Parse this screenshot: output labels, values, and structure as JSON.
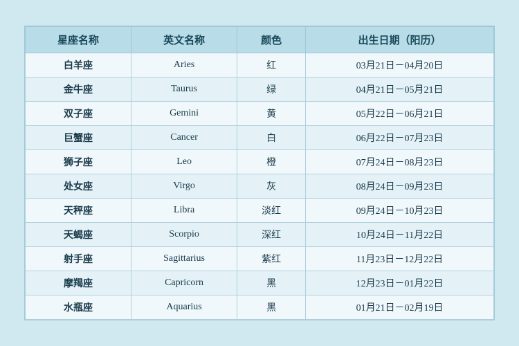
{
  "table": {
    "headers": [
      {
        "key": "chinese_name",
        "label": "星座名称"
      },
      {
        "key": "english_name",
        "label": "英文名称"
      },
      {
        "key": "color",
        "label": "颜色"
      },
      {
        "key": "date_range",
        "label": "出生日期（阳历）"
      }
    ],
    "rows": [
      {
        "chinese_name": "白羊座",
        "english_name": "Aries",
        "color": "红",
        "date_range": "03月21日－04月20日"
      },
      {
        "chinese_name": "金牛座",
        "english_name": "Taurus",
        "color": "绿",
        "date_range": "04月21日－05月21日"
      },
      {
        "chinese_name": "双子座",
        "english_name": "Gemini",
        "color": "黄",
        "date_range": "05月22日－06月21日"
      },
      {
        "chinese_name": "巨蟹座",
        "english_name": "Cancer",
        "color": "白",
        "date_range": "06月22日－07月23日"
      },
      {
        "chinese_name": "狮子座",
        "english_name": "Leo",
        "color": "橙",
        "date_range": "07月24日－08月23日"
      },
      {
        "chinese_name": "处女座",
        "english_name": "Virgo",
        "color": "灰",
        "date_range": "08月24日－09月23日"
      },
      {
        "chinese_name": "天秤座",
        "english_name": "Libra",
        "color": "淡红",
        "date_range": "09月24日－10月23日"
      },
      {
        "chinese_name": "天蝎座",
        "english_name": "Scorpio",
        "color": "深红",
        "date_range": "10月24日－11月22日"
      },
      {
        "chinese_name": "射手座",
        "english_name": "Sagittarius",
        "color": "紫红",
        "date_range": "11月23日－12月22日"
      },
      {
        "chinese_name": "摩羯座",
        "english_name": "Capricorn",
        "color": "黑",
        "date_range": "12月23日－01月22日"
      },
      {
        "chinese_name": "水瓶座",
        "english_name": "Aquarius",
        "color": "黑",
        "date_range": "01月21日－02月19日"
      }
    ]
  }
}
